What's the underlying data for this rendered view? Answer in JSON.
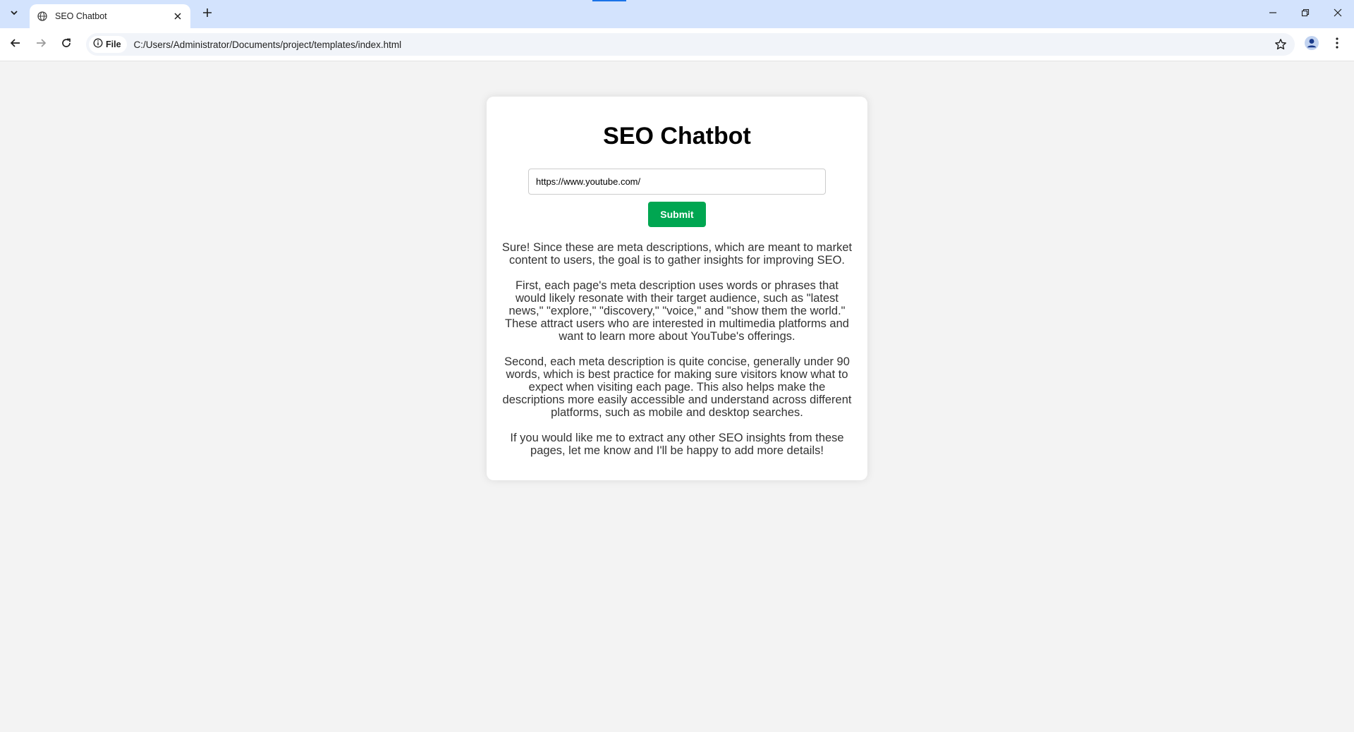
{
  "browser": {
    "tab": {
      "title": "SEO Chatbot"
    },
    "address": {
      "chip_label": "File",
      "url": "C:/Users/Administrator/Documents/project/templates/index.html"
    }
  },
  "page": {
    "title": "SEO Chatbot",
    "url_input": {
      "value": "https://www.youtube.com/"
    },
    "submit_label": "Submit",
    "response": [
      "Sure! Since these are meta descriptions, which are meant to market content to users, the goal is to gather insights for improving SEO.",
      "First, each page's meta description uses words or phrases that would likely resonate with their target audience, such as \"latest news,\" \"explore,\" \"discovery,\" \"voice,\" and \"show them the world.\" These attract users who are interested in multimedia platforms and want to learn more about YouTube's offerings.",
      "Second, each meta description is quite concise, generally under 90 words, which is best practice for making sure visitors know what to expect when visiting each page. This also helps make the descriptions more easily accessible and understand across different platforms, such as mobile and desktop searches.",
      "If you would like me to extract any other SEO insights from these pages, let me know and I'll be happy to add more details!"
    ]
  },
  "icons": {
    "tab_search": "chevron-down-icon",
    "favicon": "globe-icon",
    "tab_close": "close-icon",
    "new_tab": "plus-icon",
    "back": "back-arrow-icon",
    "forward": "forward-arrow-icon",
    "reload": "reload-icon",
    "site_info": "info-icon",
    "bookmark": "star-icon",
    "profile": "profile-icon",
    "menu": "kebab-menu-icon"
  },
  "colors": {
    "tabbar": "#d3e3fd",
    "page_background": "#f3f3f3",
    "submit_button": "#00a651"
  }
}
